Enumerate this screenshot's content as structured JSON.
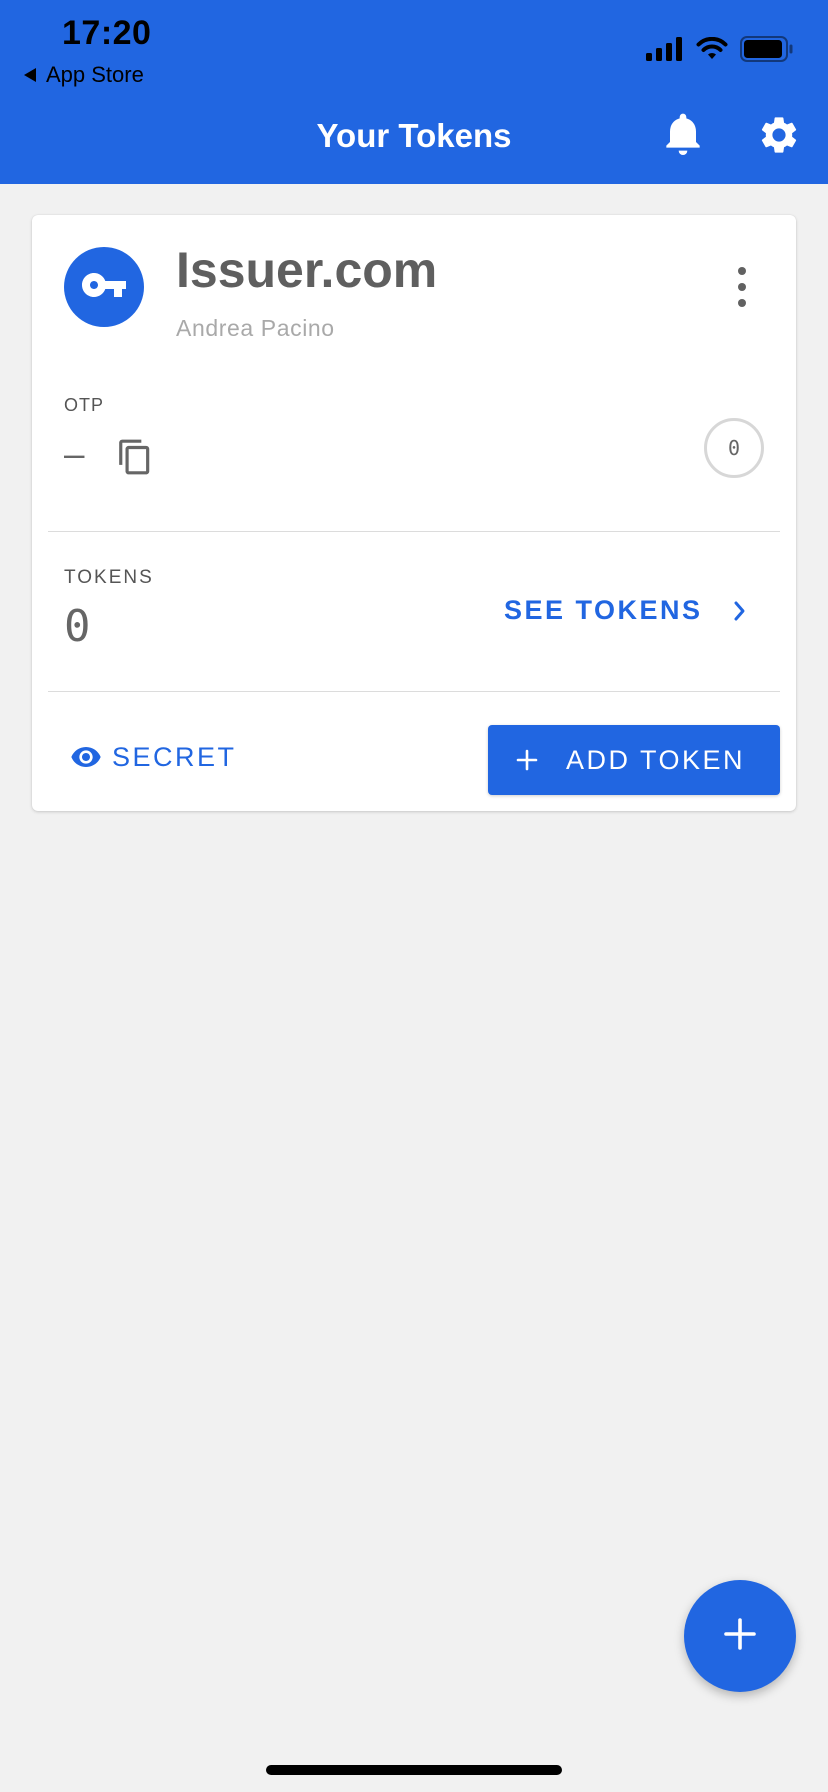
{
  "status_bar": {
    "time": "17:20",
    "back_label": "App Store"
  },
  "header": {
    "title": "Your Tokens",
    "bell_icon": "bell-icon",
    "settings_icon": "gear-icon"
  },
  "card": {
    "issuer_icon": "key-icon",
    "issuer_name": "Issuer.com",
    "user_name": "Andrea Pacino",
    "otp_label": "OTP",
    "otp_value": "–",
    "timer_value": "0",
    "tokens_label": "TOKENS",
    "tokens_count": "0",
    "see_tokens_label": "SEE TOKENS",
    "secret_label": "SECRET",
    "add_token_label": "ADD TOKEN"
  },
  "colors": {
    "primary": "#2166e1",
    "background": "#f1f1f1",
    "card": "#ffffff"
  }
}
